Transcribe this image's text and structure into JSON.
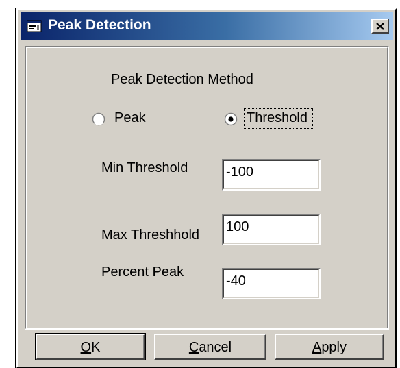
{
  "window": {
    "title": "Peak Detection",
    "icon": "app-window-icon",
    "close_icon": "close-x-icon"
  },
  "method": {
    "heading": "Peak Detection Method",
    "options": [
      {
        "label": "Peak",
        "selected": false
      },
      {
        "label": "Threshold",
        "selected": true
      }
    ]
  },
  "fields": {
    "min_threshold": {
      "label": "Min Threshold",
      "value": "-100"
    },
    "max_threshold": {
      "label": "Max Threshhold",
      "value": "100"
    },
    "percent_peak": {
      "label": "Percent Peak",
      "value": "-40"
    }
  },
  "buttons": {
    "ok": {
      "mnemonic": "O",
      "rest": "K"
    },
    "cancel": {
      "mnemonic": "C",
      "rest": "ancel"
    },
    "apply": {
      "mnemonic": "A",
      "rest": "pply"
    }
  },
  "colors": {
    "titlebar_start": "#0a246a",
    "titlebar_end": "#a6caf0",
    "dialog_face": "#d4d0c8"
  }
}
